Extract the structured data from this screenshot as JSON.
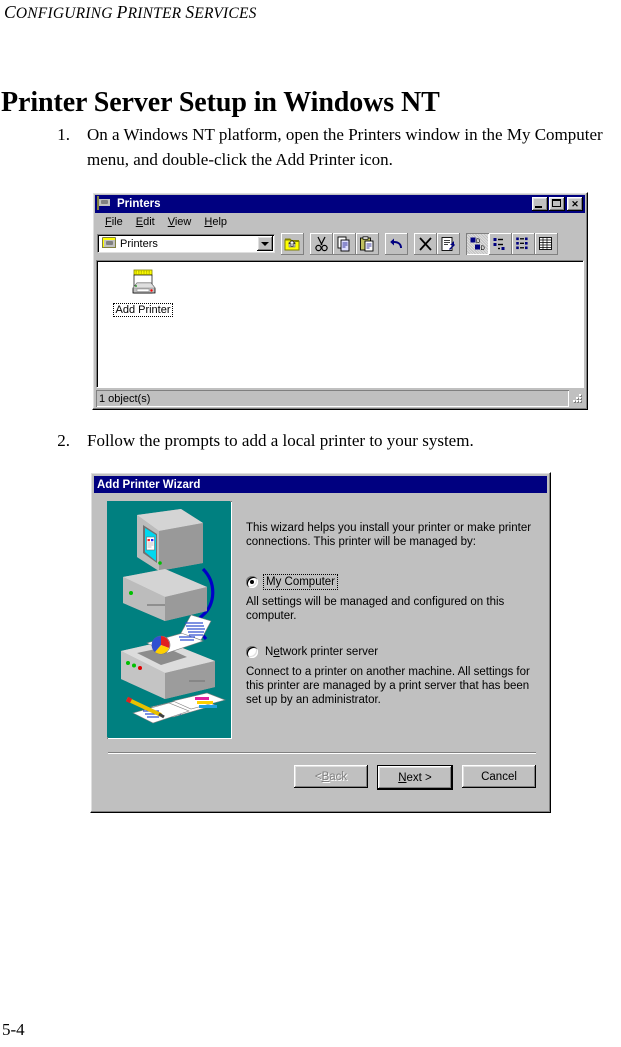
{
  "running_head": "Configuring Printer Services",
  "page_title": "Printer Server Setup in Windows NT",
  "folio": "5-4",
  "steps": [
    {
      "number": "1.",
      "text": "On a Windows NT platform, open the Printers window in the My Computer menu, and double-click the Add Printer icon."
    },
    {
      "number": "2.",
      "text": "Follow the prompts to add a local printer to your system."
    }
  ],
  "printers_window": {
    "title": "Printers",
    "title_icon": "printers-folder-icon",
    "window_buttons": [
      {
        "name": "minimize-button",
        "glyph": "_"
      },
      {
        "name": "maximize-button",
        "glyph": "□"
      },
      {
        "name": "close-button",
        "glyph": "×"
      }
    ],
    "menus": [
      {
        "label": "File",
        "accel": "F"
      },
      {
        "label": "Edit",
        "accel": "E"
      },
      {
        "label": "View",
        "accel": "V"
      },
      {
        "label": "Help",
        "accel": "H"
      }
    ],
    "path_combo": {
      "value": "Printers",
      "icon": "folder-icon"
    },
    "toolbar_buttons": [
      {
        "name": "up-one-level-icon",
        "label": "Up One Level"
      },
      {
        "name": "cut-icon",
        "label": "Cut"
      },
      {
        "name": "copy-icon",
        "label": "Copy"
      },
      {
        "name": "paste-icon",
        "label": "Paste"
      },
      {
        "name": "undo-icon",
        "label": "Undo"
      },
      {
        "name": "delete-icon",
        "label": "Delete"
      },
      {
        "name": "properties-icon",
        "label": "Properties"
      },
      {
        "name": "large-icons-icon",
        "label": "Large Icons"
      },
      {
        "name": "small-icons-icon",
        "label": "Small Icons"
      },
      {
        "name": "list-view-icon",
        "label": "List"
      },
      {
        "name": "details-view-icon",
        "label": "Details"
      }
    ],
    "items": [
      {
        "label": "Add Printer",
        "icon": "add-printer-icon",
        "selected": true
      }
    ],
    "status_text": "1 object(s)"
  },
  "wizard": {
    "title": "Add Printer Wizard",
    "intro": "This wizard helps you install your printer or make printer connections.  This printer will be managed by:",
    "options": [
      {
        "label": "My Computer",
        "accel": "",
        "selected": true,
        "focused": true,
        "description": "All settings will be managed and configured on this computer."
      },
      {
        "label": "Network printer server",
        "accel": "e",
        "selected": false,
        "focused": false,
        "description": "Connect to a printer on another machine.  All settings for this printer are managed by a print server that has been set up by an administrator."
      }
    ],
    "buttons": [
      {
        "name": "back-button",
        "label": "< Back",
        "accel": "B",
        "state": "disabled"
      },
      {
        "name": "next-button",
        "label": "Next >",
        "accel": "N",
        "state": "default"
      },
      {
        "name": "cancel-button",
        "label": "Cancel",
        "accel": "",
        "state": "normal"
      }
    ],
    "graphic": {
      "name": "printer-setup-illustration",
      "background_color": "#008080"
    }
  },
  "colors": {
    "titlebar": "#000080",
    "window_face": "#c0c0c0",
    "graphic_teal": "#008080"
  }
}
